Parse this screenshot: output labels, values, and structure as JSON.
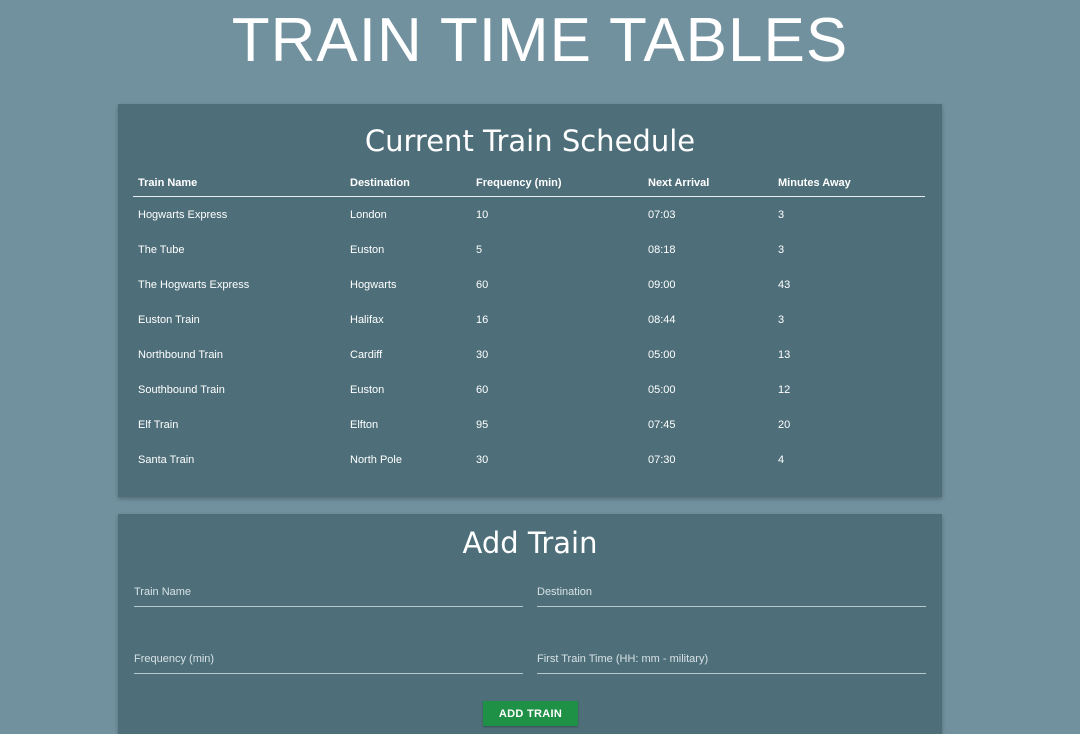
{
  "header": {
    "title": "TRAIN TIME TABLES"
  },
  "schedule": {
    "title": "Current Train Schedule",
    "columns": [
      "Train Name",
      "Destination",
      "Frequency (min)",
      "Next Arrival",
      "Minutes Away"
    ],
    "rows": [
      [
        "Hogwarts Express",
        "London",
        "10",
        "07:03",
        "3"
      ],
      [
        "The Tube",
        "Euston",
        "5",
        "08:18",
        "3"
      ],
      [
        "The Hogwarts Express",
        "Hogwarts",
        "60",
        "09:00",
        "43"
      ],
      [
        "Euston Train",
        "Halifax",
        "16",
        "08:44",
        "3"
      ],
      [
        "Northbound Train",
        "Cardiff",
        "30",
        "05:00",
        "13"
      ],
      [
        "Southbound Train",
        "Euston",
        "60",
        "05:00",
        "12"
      ],
      [
        "Elf Train",
        "Elfton",
        "95",
        "07:45",
        "20"
      ],
      [
        "Santa Train",
        "North Pole",
        "30",
        "07:30",
        "4"
      ]
    ]
  },
  "add_train": {
    "title": "Add Train",
    "name_placeholder": "Train Name",
    "destination_placeholder": "Destination",
    "frequency_placeholder": "Frequency (min)",
    "first_time_placeholder": "First Train Time (HH: mm - military)",
    "button_label": "ADD TRAIN"
  },
  "colors": {
    "background": "#72919e",
    "card": "#4e6f7a",
    "button": "#1e9146"
  }
}
